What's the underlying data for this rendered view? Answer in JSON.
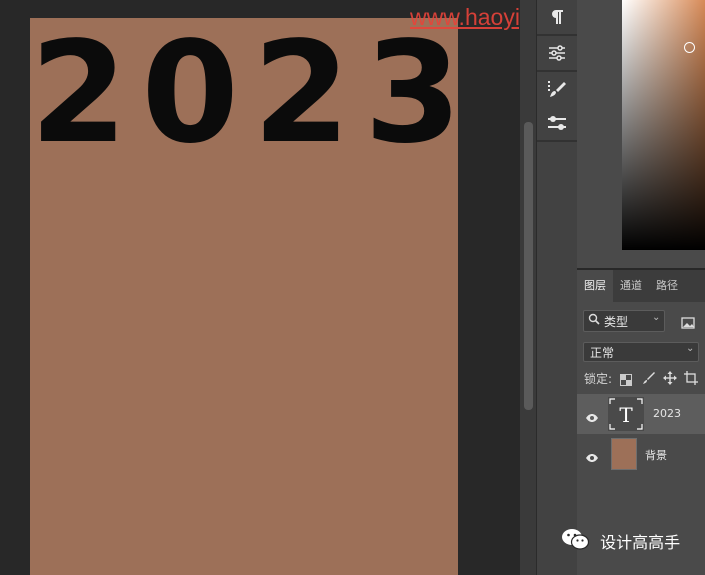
{
  "canvas": {
    "big_text": "2023",
    "fill_color": "#9d7058",
    "text_color": "#0b0b0b",
    "watermark_url": "www.haoyipingmheji.com"
  },
  "tool_strip": {
    "items": [
      "paragraph-icon",
      "adjustments-icon",
      "brush-settings-icon",
      "sliders-icon"
    ]
  },
  "layers_panel": {
    "tabs": [
      {
        "label": "图层",
        "active": true
      },
      {
        "label": "通道",
        "active": false
      },
      {
        "label": "路径",
        "active": false
      }
    ],
    "filter": {
      "label": "类型"
    },
    "blend_mode": "正常",
    "lock_label": "锁定:",
    "layers": [
      {
        "name": "2023",
        "kind": "text",
        "selected": true,
        "visible": true
      },
      {
        "name": "背景",
        "kind": "fill",
        "selected": false,
        "visible": true
      }
    ]
  },
  "watermark_badge": {
    "label": "设计高高手"
  }
}
